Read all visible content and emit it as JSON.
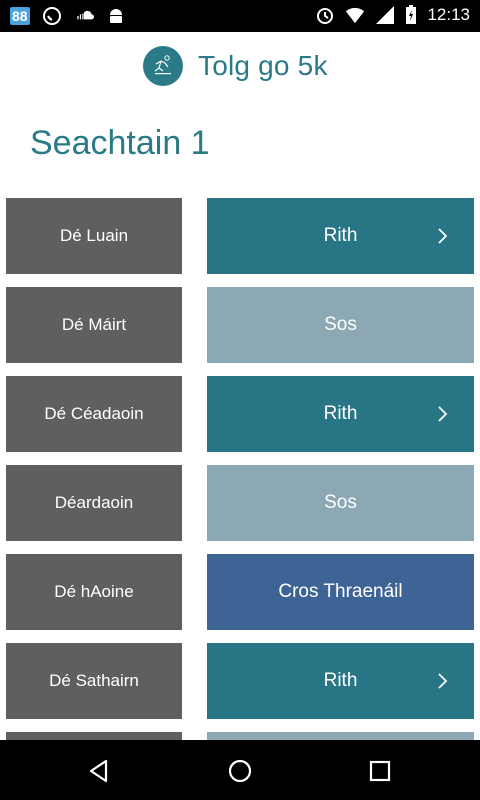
{
  "status_bar": {
    "notification_badge": "88",
    "time": "12:13",
    "icons": [
      "badge-88-icon",
      "whatsapp-icon",
      "soundcloud-icon",
      "android-icon",
      "alarm-icon",
      "wifi-icon",
      "signal-icon",
      "battery-charging-icon"
    ]
  },
  "header": {
    "app_title": "Tolg go 5k",
    "logo_name": "na-rasai-logo"
  },
  "week_title": "Seachtain 1",
  "rows": [
    {
      "day": "Dé Luain",
      "activity": "Rith",
      "type": "run",
      "has_chevron": true
    },
    {
      "day": "Dé Máirt",
      "activity": "Sos",
      "type": "rest",
      "has_chevron": false
    },
    {
      "day": "Dé Céadaoin",
      "activity": "Rith",
      "type": "run",
      "has_chevron": true
    },
    {
      "day": "Déardaoin",
      "activity": "Sos",
      "type": "rest",
      "has_chevron": false
    },
    {
      "day": "Dé hAoine",
      "activity": "Cros Thraenáil",
      "type": "cross",
      "has_chevron": false
    },
    {
      "day": "Dé Sathairn",
      "activity": "Rith",
      "type": "run",
      "has_chevron": true
    },
    {
      "day": "",
      "activity": "",
      "type": "rest",
      "has_chevron": false
    }
  ],
  "colors": {
    "run": "#287585",
    "rest": "#8ba8b4",
    "cross": "#3e6496",
    "day": "#5f5f5f",
    "accent": "#2a7a88"
  },
  "nav": {
    "back": "back-icon",
    "home": "home-icon",
    "recents": "recents-icon"
  }
}
